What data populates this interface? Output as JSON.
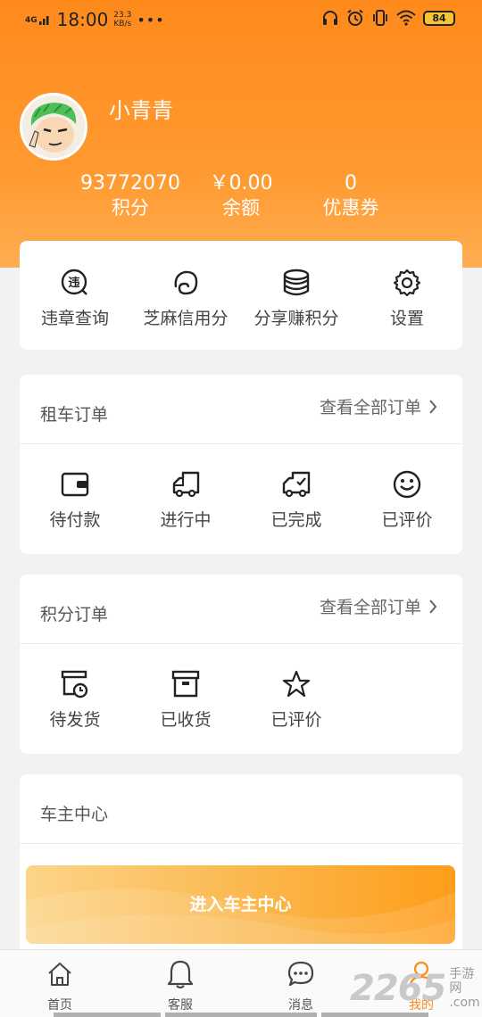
{
  "status_bar": {
    "signal": "4G",
    "time": "18:00",
    "speed_value": "23.3",
    "speed_unit": "KB/s",
    "dots": "•••",
    "battery": "84"
  },
  "profile": {
    "username": "小青青",
    "stats": [
      {
        "value": "93772070",
        "label": "积分"
      },
      {
        "value": "￥0.00",
        "label": "余额"
      },
      {
        "value": "0",
        "label": "优惠券"
      }
    ]
  },
  "quick_actions": [
    {
      "icon": "violation-icon",
      "label": "违章查询"
    },
    {
      "icon": "sesame-credit-icon",
      "label": "芝麻信用分"
    },
    {
      "icon": "coins-icon",
      "label": "分享赚积分"
    },
    {
      "icon": "gear-icon",
      "label": "设置"
    }
  ],
  "violation_icon_char": "违",
  "rental_orders": {
    "title": "租车订单",
    "view_all": "查看全部订单",
    "items": [
      {
        "icon": "wallet-icon",
        "label": "待付款"
      },
      {
        "icon": "truck-icon",
        "label": "进行中"
      },
      {
        "icon": "truck-check-icon",
        "label": "已完成"
      },
      {
        "icon": "smiley-icon",
        "label": "已评价"
      }
    ]
  },
  "points_orders": {
    "title": "积分订单",
    "view_all": "查看全部订单",
    "items": [
      {
        "icon": "box-clock-icon",
        "label": "待发货"
      },
      {
        "icon": "box-icon",
        "label": "已收货"
      },
      {
        "icon": "star-icon",
        "label": "已评价"
      }
    ]
  },
  "owner_center": {
    "title": "车主中心",
    "button": "进入车主中心"
  },
  "tabbar": [
    {
      "icon": "home-icon",
      "label": "首页"
    },
    {
      "icon": "bell-icon",
      "label": "客服"
    },
    {
      "icon": "chat-icon",
      "label": "消息"
    },
    {
      "icon": "person-icon",
      "label": "我的",
      "active": true
    }
  ],
  "watermark": {
    "number": "2265",
    "text_line1": "手游网",
    "text_line2": ".com"
  },
  "colors": {
    "accent": "#ff8a1c",
    "background": "#f2f2f2",
    "card": "#ffffff"
  }
}
